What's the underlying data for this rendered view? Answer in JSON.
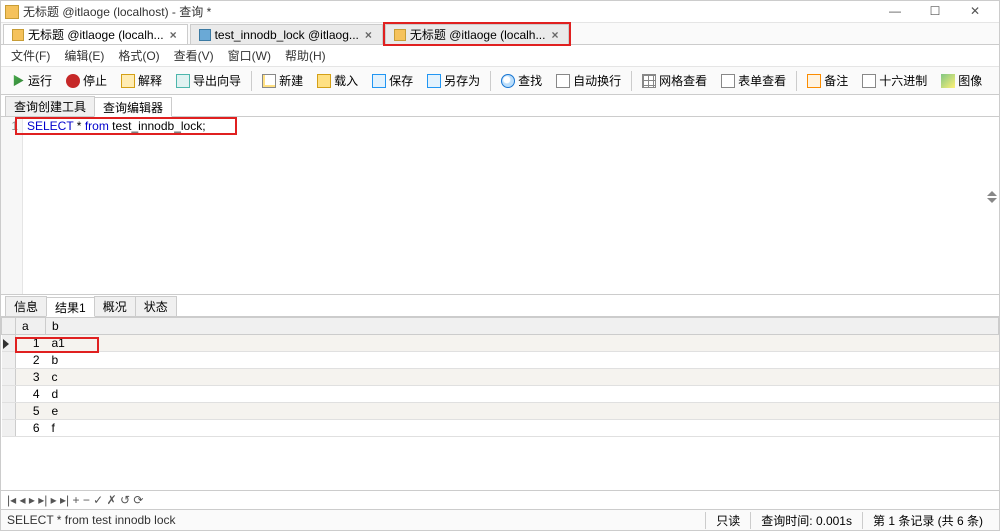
{
  "window": {
    "title": "无标题 @itlaoge (localhost) - 查询 *"
  },
  "docTabs": [
    {
      "label": "无标题 @itlaoge (localh...",
      "active": true
    },
    {
      "label": "test_innodb_lock @itlaog...",
      "active": false
    },
    {
      "label": "无标题 @itlaoge (localh...",
      "active": false,
      "highlighted": true
    }
  ],
  "menu": {
    "file": "文件(F)",
    "edit": "编辑(E)",
    "fmt": "格式(O)",
    "view": "查看(V)",
    "window": "窗口(W)",
    "help": "帮助(H)"
  },
  "toolbar": {
    "run": "运行",
    "stop": "停止",
    "explain": "解释",
    "export": "导出向导",
    "new": "新建",
    "load": "载入",
    "save": "保存",
    "saveas": "另存为",
    "find": "查找",
    "wrap": "自动换行",
    "gridview": "网格查看",
    "formview": "表单查看",
    "note": "备注",
    "hex": "十六进制",
    "img": "图像"
  },
  "subTabs": {
    "builder": "查询创建工具",
    "editor": "查询编辑器"
  },
  "editor": {
    "lineNo": "1",
    "sql_kw1": "SELECT",
    "sql_mid": " * ",
    "sql_kw2": "from",
    "sql_rest": " test_innodb_lock;"
  },
  "resultTabs": {
    "info": "信息",
    "result": "结果1",
    "profile": "概况",
    "state": "状态"
  },
  "grid": {
    "cols": {
      "a": "a",
      "b": "b"
    },
    "rows": [
      {
        "a": "1",
        "b": "a1"
      },
      {
        "a": "2",
        "b": "b"
      },
      {
        "a": "3",
        "b": "c"
      },
      {
        "a": "4",
        "b": "d"
      },
      {
        "a": "5",
        "b": "e"
      },
      {
        "a": "6",
        "b": "f"
      }
    ]
  },
  "nav": {
    "controls": "|◂  ◂  ▸  ▸|  ▸  ▸|  +  −  ✓  ✗   ↺  ⟳"
  },
  "status": {
    "sql": "SELECT * from test innodb lock",
    "readonly": "只读",
    "qtime": "查询时间: 0.001s",
    "rec": "第 1 条记录 (共 6 条)"
  }
}
